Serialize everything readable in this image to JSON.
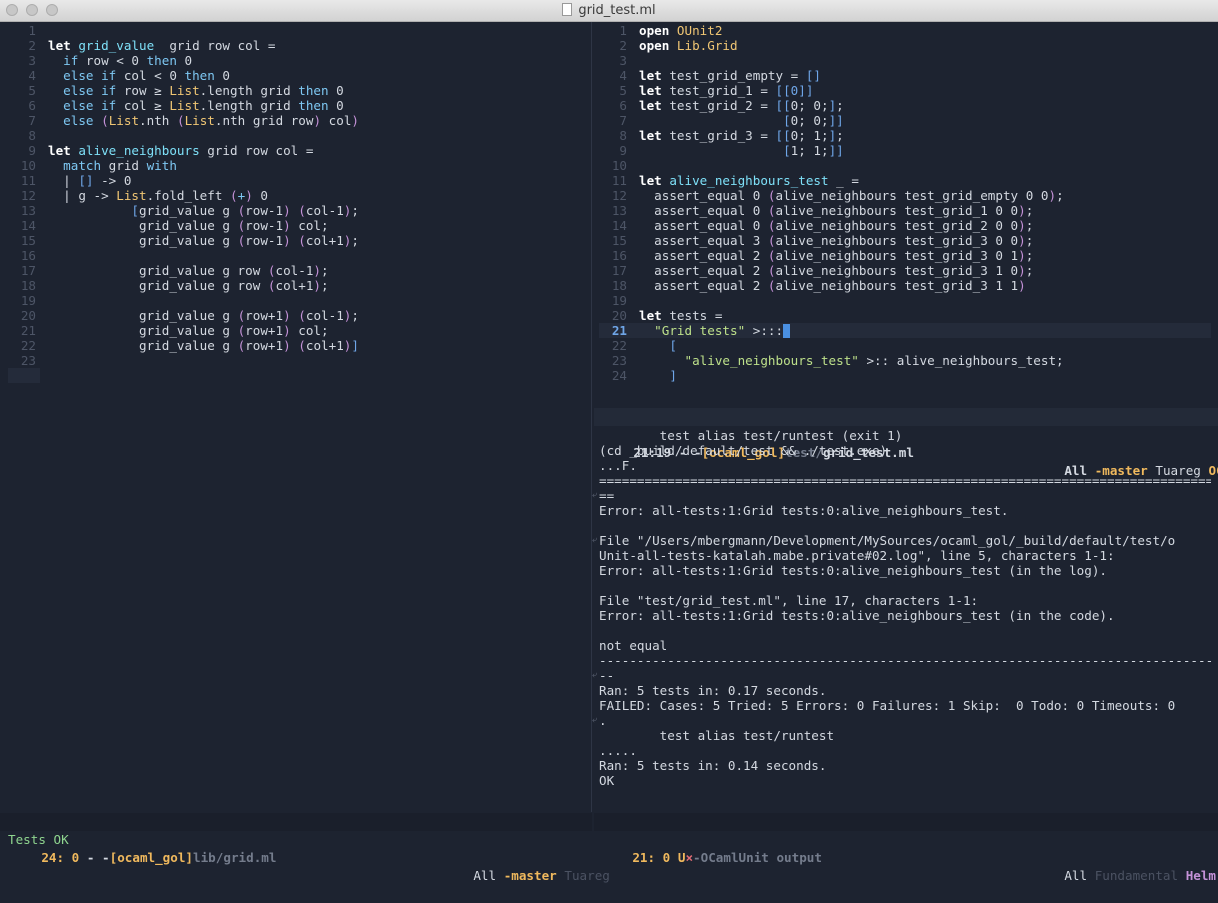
{
  "window": {
    "title": "grid_test.ml"
  },
  "left_pane": {
    "lines": [
      {
        "n": "1",
        "t": []
      },
      {
        "n": "2",
        "t": [
          [
            "kwb",
            "let "
          ],
          [
            "fn",
            "grid_value"
          ],
          [
            "",
            "  grid row col ="
          ]
        ]
      },
      {
        "n": "3",
        "t": [
          [
            "",
            "  "
          ],
          [
            "kw",
            "if"
          ],
          [
            "",
            " row < 0 "
          ],
          [
            "kw",
            "then"
          ],
          [
            "",
            " 0"
          ]
        ]
      },
      {
        "n": "4",
        "t": [
          [
            "",
            "  "
          ],
          [
            "kw",
            "else if"
          ],
          [
            "",
            " col < 0 "
          ],
          [
            "kw",
            "then"
          ],
          [
            "",
            " 0"
          ]
        ]
      },
      {
        "n": "5",
        "t": [
          [
            "",
            "  "
          ],
          [
            "kw",
            "else if"
          ],
          [
            "",
            " row ≥ "
          ],
          [
            "mod",
            "List"
          ],
          [
            "",
            ".length grid "
          ],
          [
            "kw",
            "then"
          ],
          [
            "",
            " 0"
          ]
        ]
      },
      {
        "n": "6",
        "t": [
          [
            "",
            "  "
          ],
          [
            "kw",
            "else if"
          ],
          [
            "",
            " col ≥ "
          ],
          [
            "mod",
            "List"
          ],
          [
            "",
            ".length grid "
          ],
          [
            "kw",
            "then"
          ],
          [
            "",
            " 0"
          ]
        ]
      },
      {
        "n": "7",
        "t": [
          [
            "",
            "  "
          ],
          [
            "kw",
            "else"
          ],
          [
            "",
            " "
          ],
          [
            "paren",
            "("
          ],
          [
            "mod",
            "List"
          ],
          [
            "",
            ".nth "
          ],
          [
            "paren",
            "("
          ],
          [
            "mod",
            "List"
          ],
          [
            "",
            ".nth grid row"
          ],
          [
            "paren",
            ")"
          ],
          [
            "",
            " col"
          ],
          [
            "paren",
            ")"
          ]
        ]
      },
      {
        "n": "8",
        "t": []
      },
      {
        "n": "9",
        "t": [
          [
            "kwb",
            "let "
          ],
          [
            "fn",
            "alive_neighbours"
          ],
          [
            "",
            " grid row col ="
          ]
        ]
      },
      {
        "n": "10",
        "t": [
          [
            "",
            "  "
          ],
          [
            "kw",
            "match"
          ],
          [
            "",
            " grid "
          ],
          [
            "kw",
            "with"
          ]
        ]
      },
      {
        "n": "11",
        "t": [
          [
            "",
            "  | "
          ],
          [
            "brk",
            "[]"
          ],
          [
            "",
            " -> 0"
          ]
        ]
      },
      {
        "n": "12",
        "t": [
          [
            "",
            "  | g -> "
          ],
          [
            "mod",
            "List"
          ],
          [
            "",
            ".fold_left "
          ],
          [
            "paren",
            "("
          ],
          [
            "kw",
            "+"
          ],
          [
            "paren",
            ")"
          ],
          [
            "",
            " 0"
          ]
        ]
      },
      {
        "n": "13",
        "t": [
          [
            "",
            "           "
          ],
          [
            "brk",
            "["
          ],
          [
            "",
            "grid_value g "
          ],
          [
            "paren",
            "("
          ],
          [
            "",
            "row-1"
          ],
          [
            "paren",
            ")"
          ],
          [
            "",
            " "
          ],
          [
            "paren",
            "("
          ],
          [
            "",
            "col-1"
          ],
          [
            "paren",
            ")"
          ],
          [
            "",
            ";"
          ]
        ]
      },
      {
        "n": "14",
        "t": [
          [
            "",
            "            grid_value g "
          ],
          [
            "paren",
            "("
          ],
          [
            "",
            "row-1"
          ],
          [
            "paren",
            ")"
          ],
          [
            "",
            " col;"
          ]
        ]
      },
      {
        "n": "15",
        "t": [
          [
            "",
            "            grid_value g "
          ],
          [
            "paren",
            "("
          ],
          [
            "",
            "row-1"
          ],
          [
            "paren",
            ")"
          ],
          [
            "",
            " "
          ],
          [
            "paren",
            "("
          ],
          [
            "",
            "col+1"
          ],
          [
            "paren",
            ")"
          ],
          [
            "",
            ";"
          ]
        ]
      },
      {
        "n": "16",
        "t": []
      },
      {
        "n": "17",
        "t": [
          [
            "",
            "            grid_value g row "
          ],
          [
            "paren",
            "("
          ],
          [
            "",
            "col-1"
          ],
          [
            "paren",
            ")"
          ],
          [
            "",
            ";"
          ]
        ]
      },
      {
        "n": "18",
        "t": [
          [
            "",
            "            grid_value g row "
          ],
          [
            "paren",
            "("
          ],
          [
            "",
            "col+1"
          ],
          [
            "paren",
            ")"
          ],
          [
            "",
            ";"
          ]
        ]
      },
      {
        "n": "19",
        "t": []
      },
      {
        "n": "20",
        "t": [
          [
            "",
            "            grid_value g "
          ],
          [
            "paren",
            "("
          ],
          [
            "",
            "row+1"
          ],
          [
            "paren",
            ")"
          ],
          [
            "",
            " "
          ],
          [
            "paren",
            "("
          ],
          [
            "",
            "col-1"
          ],
          [
            "paren",
            ")"
          ],
          [
            "",
            ";"
          ]
        ]
      },
      {
        "n": "21",
        "t": [
          [
            "",
            "            grid_value g "
          ],
          [
            "paren",
            "("
          ],
          [
            "",
            "row+1"
          ],
          [
            "paren",
            ")"
          ],
          [
            "",
            " col;"
          ]
        ]
      },
      {
        "n": "22",
        "t": [
          [
            "",
            "            grid_value g "
          ],
          [
            "paren",
            "("
          ],
          [
            "",
            "row+1"
          ],
          [
            "paren",
            ")"
          ],
          [
            "",
            " "
          ],
          [
            "paren",
            "("
          ],
          [
            "",
            "col+1"
          ],
          [
            "paren",
            ")"
          ],
          [
            "brk",
            "]"
          ]
        ]
      },
      {
        "n": "23",
        "t": []
      },
      {
        "n": "",
        "t": []
      }
    ]
  },
  "right_pane": {
    "lines": [
      {
        "n": "1",
        "t": [
          [
            "kwb",
            "open "
          ],
          [
            "mod",
            "OUnit2"
          ]
        ]
      },
      {
        "n": "2",
        "t": [
          [
            "kwb",
            "open "
          ],
          [
            "mod",
            "Lib.Grid"
          ]
        ]
      },
      {
        "n": "3",
        "t": []
      },
      {
        "n": "4",
        "t": [
          [
            "kwb",
            "let"
          ],
          [
            "",
            " test_grid_empty = "
          ],
          [
            "brk",
            "[]"
          ]
        ]
      },
      {
        "n": "5",
        "t": [
          [
            "kwb",
            "let"
          ],
          [
            "",
            " test_grid_1 = "
          ],
          [
            "brk",
            "[[0]]"
          ]
        ]
      },
      {
        "n": "6",
        "t": [
          [
            "kwb",
            "let"
          ],
          [
            "",
            " test_grid_2 = "
          ],
          [
            "brk",
            "[["
          ],
          [
            "",
            "0; 0;"
          ],
          [
            "brk",
            "]"
          ],
          [
            "",
            ";"
          ]
        ]
      },
      {
        "n": "7",
        "t": [
          [
            "",
            "                   "
          ],
          [
            "brk",
            "["
          ],
          [
            "",
            "0; 0;"
          ],
          [
            "brk",
            "]]"
          ]
        ]
      },
      {
        "n": "8",
        "t": [
          [
            "kwb",
            "let"
          ],
          [
            "",
            " test_grid_3 = "
          ],
          [
            "brk",
            "[["
          ],
          [
            "",
            "0; 1;"
          ],
          [
            "brk",
            "]"
          ],
          [
            "",
            ";"
          ]
        ]
      },
      {
        "n": "9",
        "t": [
          [
            "",
            "                   "
          ],
          [
            "brk",
            "["
          ],
          [
            "",
            "1; 1;"
          ],
          [
            "brk",
            "]]"
          ]
        ]
      },
      {
        "n": "10",
        "t": []
      },
      {
        "n": "11",
        "t": [
          [
            "kwb",
            "let"
          ],
          [
            "",
            " "
          ],
          [
            "fn",
            "alive_neighbours_test"
          ],
          [
            "",
            " _ ="
          ]
        ]
      },
      {
        "n": "12",
        "t": [
          [
            "",
            "  assert_equal 0 "
          ],
          [
            "paren",
            "("
          ],
          [
            "",
            "alive_neighbours test_grid_empty 0 0"
          ],
          [
            "paren",
            ")"
          ],
          [
            "",
            ";"
          ]
        ]
      },
      {
        "n": "13",
        "t": [
          [
            "",
            "  assert_equal 0 "
          ],
          [
            "paren",
            "("
          ],
          [
            "",
            "alive_neighbours test_grid_1 0 0"
          ],
          [
            "paren",
            ")"
          ],
          [
            "",
            ";"
          ]
        ]
      },
      {
        "n": "14",
        "t": [
          [
            "",
            "  assert_equal 0 "
          ],
          [
            "paren",
            "("
          ],
          [
            "",
            "alive_neighbours test_grid_2 0 0"
          ],
          [
            "paren",
            ")"
          ],
          [
            "",
            ";"
          ]
        ]
      },
      {
        "n": "15",
        "t": [
          [
            "",
            "  assert_equal 3 "
          ],
          [
            "paren",
            "("
          ],
          [
            "",
            "alive_neighbours test_grid_3 0 0"
          ],
          [
            "paren",
            ")"
          ],
          [
            "",
            ";"
          ]
        ]
      },
      {
        "n": "16",
        "t": [
          [
            "",
            "  assert_equal 2 "
          ],
          [
            "paren",
            "("
          ],
          [
            "",
            "alive_neighbours test_grid_3 0 1"
          ],
          [
            "paren",
            ")"
          ],
          [
            "",
            ";"
          ]
        ]
      },
      {
        "n": "17",
        "t": [
          [
            "",
            "  assert_equal 2 "
          ],
          [
            "paren",
            "("
          ],
          [
            "",
            "alive_neighbours test_grid_3 1 0"
          ],
          [
            "paren",
            ")"
          ],
          [
            "",
            ";"
          ]
        ]
      },
      {
        "n": "18",
        "t": [
          [
            "",
            "  assert_equal 2 "
          ],
          [
            "paren",
            "("
          ],
          [
            "",
            "alive_neighbours test_grid_3 1 1"
          ],
          [
            "paren",
            ")"
          ]
        ]
      },
      {
        "n": "19",
        "t": []
      },
      {
        "n": "20",
        "t": [
          [
            "kwb",
            "let"
          ],
          [
            "",
            " tests ="
          ]
        ]
      },
      {
        "n": "21",
        "t": [
          [
            "",
            "  "
          ],
          [
            "str",
            "\"Grid tests\""
          ],
          [
            "",
            " >:::"
          ]
        ],
        "current": true
      },
      {
        "n": "22",
        "t": [
          [
            "",
            "    "
          ],
          [
            "brk",
            "["
          ]
        ]
      },
      {
        "n": "23",
        "t": [
          [
            "",
            "      "
          ],
          [
            "str",
            "\"alive_neighbours_test\""
          ],
          [
            "",
            " >:: alive_neighbours_test;"
          ]
        ]
      },
      {
        "n": "24",
        "t": [
          [
            "",
            "    "
          ],
          [
            "brk",
            "]"
          ]
        ]
      }
    ]
  },
  "right_modeline": {
    "position": "21:19",
    "sep": " - -",
    "project": "[ocaml_gol]",
    "dir": "test/",
    "file": "grid_test.ml",
    "scope": "All",
    "branch": "-master",
    "mode": "Tuareg",
    "lang": "OCam"
  },
  "output": {
    "lines": [
      "        test alias test/runtest (exit 1)",
      "(cd _build/default/test && ./test.exe)",
      "...F.",
      "========================================================================================",
      "==",
      "Error: all-tests:1:Grid tests:0:alive_neighbours_test.",
      "",
      "File \"/Users/mbergmann/Development/MySources/ocaml_gol/_build/default/test/o",
      "Unit-all-tests-katalah.mabe.private#02.log\", line 5, characters 1-1:",
      "Error: all-tests:1:Grid tests:0:alive_neighbours_test (in the log).",
      "",
      "File \"test/grid_test.ml\", line 17, characters 1-1:",
      "Error: all-tests:1:Grid tests:0:alive_neighbours_test (in the code).",
      "",
      "not equal",
      "----------------------------------------------------------------------------------------",
      "--",
      "Ran: 5 tests in: 0.17 seconds.",
      "FAILED: Cases: 5 Tried: 5 Errors: 0 Failures: 1 Skip:  0 Todo: 0 Timeouts: 0",
      ".",
      "        test alias test/runtest",
      ".....",
      "Ran: 5 tests in: 0.14 seconds.",
      "OK"
    ]
  },
  "left_modeline": {
    "position": "24: 0",
    "sep": " - -",
    "project": "[ocaml_gol]",
    "dir": "lib/",
    "file": "grid.ml",
    "scope": "All",
    "branch": "-master",
    "mode": "Tuareg"
  },
  "bottom_right_modeline": {
    "position": "21: 0",
    "status": "U",
    "x": "×",
    "buffer": "-OCamlUnit output",
    "scope": "All",
    "mode": "Fundamental",
    "helm": "Helm +"
  },
  "echo_area": "Tests OK"
}
